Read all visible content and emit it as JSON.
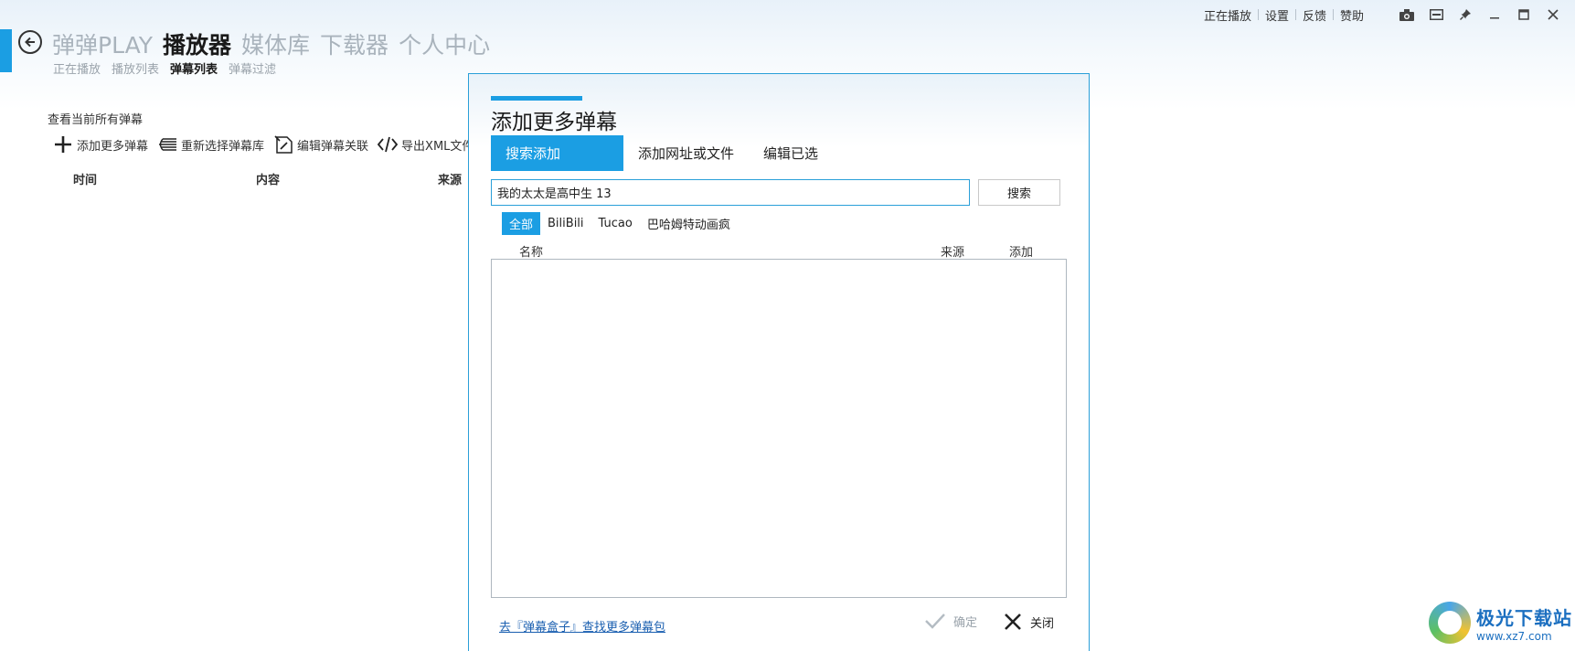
{
  "window_controls": {
    "links": [
      "正在播放",
      "设置",
      "反馈",
      "赞助"
    ],
    "icons": [
      "camera-icon",
      "mini-mode-icon",
      "pin-icon",
      "minimize-icon",
      "maximize-icon",
      "close-icon"
    ]
  },
  "nav": {
    "main": [
      "弹弹PLAY",
      "播放器",
      "媒体库",
      "下载器",
      "个人中心"
    ],
    "main_active": "播放器",
    "sub": [
      "正在播放",
      "播放列表",
      "弹幕列表",
      "弹幕过滤"
    ],
    "sub_active": "弹幕列表"
  },
  "panel": {
    "title": "查看当前所有弹幕",
    "toolbar": [
      "添加更多弹幕",
      "重新选择弹幕库",
      "编辑弹幕关联",
      "导出XML文件"
    ],
    "columns": [
      "时间",
      "内容",
      "来源"
    ]
  },
  "dialog": {
    "title": "添加更多弹幕",
    "tabs": [
      "搜索添加",
      "添加网址或文件",
      "编辑已选"
    ],
    "active_tab": "搜索添加",
    "search_value": "我的太太是高中生 13",
    "search_button": "搜索",
    "filters": [
      "全部",
      "BiliBili",
      "Tucao",
      "巴哈姆特动画疯"
    ],
    "active_filter": "全部",
    "list_columns": [
      "名称",
      "来源",
      "添加"
    ],
    "footer_link": "去『弹幕盒子』查找更多弹幕包",
    "confirm_label": "确定",
    "close_label": "关闭"
  },
  "watermark": {
    "text": "极光下载站",
    "url": "www.xz7.com"
  },
  "colors": {
    "accent": "#1b9ee3",
    "muted_nav": "#a9b3bc",
    "border": "#2a9fd8"
  }
}
